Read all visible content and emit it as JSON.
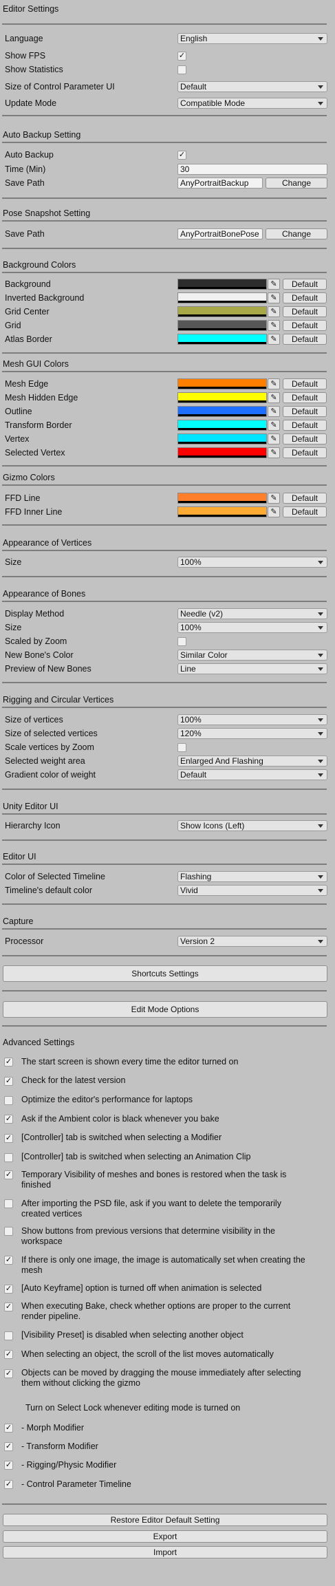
{
  "editor_settings": {
    "header": "Editor Settings",
    "language": {
      "label": "Language",
      "value": "English"
    },
    "show_fps": {
      "label": "Show FPS",
      "checked": true
    },
    "show_statistics": {
      "label": "Show Statistics",
      "checked": false
    },
    "cp_ui_size": {
      "label": "Size of Control Parameter UI",
      "value": "Default"
    },
    "update_mode": {
      "label": "Update Mode",
      "value": "Compatible Mode"
    }
  },
  "auto_backup": {
    "header": "Auto Backup Setting",
    "enabled": {
      "label": "Auto Backup",
      "checked": true
    },
    "time": {
      "label": "Time (Min)",
      "value": "30"
    },
    "save_path": {
      "label": "Save Path",
      "value": "AnyPortraitBackup",
      "button": "Change"
    }
  },
  "pose_snapshot": {
    "header": "Pose Snapshot Setting",
    "save_path": {
      "label": "Save Path",
      "value": "AnyPortraitBonePose",
      "button": "Change"
    }
  },
  "background_colors": {
    "header": "Background Colors",
    "default_label": "Default",
    "items": [
      {
        "label": "Background",
        "color": "#2d2d2d"
      },
      {
        "label": "Inverted Background",
        "color": "#f0f0f0"
      },
      {
        "label": "Grid Center",
        "color": "#a8a848"
      },
      {
        "label": "Grid",
        "color": "#575757"
      },
      {
        "label": "Atlas Border",
        "color": "#00ffff"
      }
    ]
  },
  "mesh_gui_colors": {
    "header": "Mesh GUI Colors",
    "default_label": "Default",
    "items": [
      {
        "label": "Mesh Edge",
        "color": "#ff8000"
      },
      {
        "label": "Mesh Hidden Edge",
        "color": "#ffff00"
      },
      {
        "label": "Outline",
        "color": "#1f6fff"
      },
      {
        "label": "Transform Border",
        "color": "#00ffff"
      },
      {
        "label": "Vertex",
        "color": "#00e5ff"
      },
      {
        "label": "Selected Vertex",
        "color": "#ff0000"
      }
    ]
  },
  "gizmo_colors": {
    "header": "Gizmo Colors",
    "default_label": "Default",
    "items": [
      {
        "label": "FFD Line",
        "color": "#ff7f2a"
      },
      {
        "label": "FFD Inner Line",
        "color": "#ffab33"
      }
    ]
  },
  "appearance_vertices": {
    "header": "Appearance of Vertices",
    "size": {
      "label": "Size",
      "value": "100%"
    }
  },
  "appearance_bones": {
    "header": "Appearance of Bones",
    "display_method": {
      "label": "Display Method",
      "value": "Needle (v2)"
    },
    "size": {
      "label": "Size",
      "value": "100%"
    },
    "scaled_by_zoom": {
      "label": "Scaled by Zoom",
      "checked": false
    },
    "new_bone_color": {
      "label": "New Bone's Color",
      "value": "Similar Color"
    },
    "preview_new_bones": {
      "label": "Preview of New Bones",
      "value": "Line"
    }
  },
  "rigging": {
    "header": "Rigging and Circular Vertices",
    "size_vertices": {
      "label": "Size of vertices",
      "value": "100%"
    },
    "size_selected": {
      "label": "Size of selected vertices",
      "value": "120%"
    },
    "scale_by_zoom": {
      "label": "Scale vertices by Zoom",
      "checked": false
    },
    "weight_area": {
      "label": "Selected weight area",
      "value": "Enlarged And Flashing"
    },
    "gradient": {
      "label": "Gradient color of weight",
      "value": "Default"
    }
  },
  "unity_editor_ui": {
    "header": "Unity Editor UI",
    "hierarchy_icon": {
      "label": "Hierarchy Icon",
      "value": "Show Icons (Left)"
    }
  },
  "editor_ui": {
    "header": "Editor UI",
    "timeline_color": {
      "label": "Color of Selected Timeline",
      "value": "Flashing"
    },
    "timeline_default": {
      "label": "Timeline's default color",
      "value": "Vivid"
    }
  },
  "capture": {
    "header": "Capture",
    "processor": {
      "label": "Processor",
      "value": "Version 2"
    }
  },
  "buttons": {
    "shortcuts": "Shortcuts Settings",
    "edit_mode": "Edit Mode Options",
    "restore": "Restore Editor Default Setting",
    "export": "Export",
    "import": "Import"
  },
  "advanced": {
    "header": "Advanced Settings",
    "items": [
      {
        "label": "The start screen is shown every time the editor turned on",
        "checked": true
      },
      {
        "label": "Check for the latest version",
        "checked": true
      },
      {
        "label": "Optimize the editor's performance for laptops",
        "checked": false
      },
      {
        "label": "Ask if the Ambient color is black whenever you bake",
        "checked": true
      },
      {
        "label": "[Controller] tab is switched when selecting a Modifier",
        "checked": true
      },
      {
        "label": "[Controller] tab is switched when selecting an Animation Clip",
        "checked": false
      },
      {
        "label": "Temporary Visibility of meshes and bones is restored when the task is finished",
        "checked": true
      },
      {
        "label": "After importing the PSD file, ask if you want to delete the temporarily created vertices",
        "checked": false
      },
      {
        "label": "Show buttons from previous versions that determine visibility in the workspace",
        "checked": false
      },
      {
        "label": "If there is only one image, the image is automatically set when creating the mesh",
        "checked": true
      },
      {
        "label": "[Auto Keyframe] option is turned off when animation is selected",
        "checked": true
      },
      {
        "label": "When executing Bake, check whether options are proper to the current render pipeline.",
        "checked": true
      },
      {
        "label": "[Visibility Preset] is disabled when selecting another object",
        "checked": false
      },
      {
        "label": "When selecting an object, the scroll of the list moves automatically",
        "checked": true
      },
      {
        "label": "Objects can be moved by dragging the mouse immediately after selecting them without clicking the gizmo",
        "checked": true
      }
    ],
    "select_lock_label": "Turn on Select Lock whenever editing mode is turned on",
    "lock_items": [
      {
        "label": "- Morph Modifier",
        "checked": true
      },
      {
        "label": "- Transform Modifier",
        "checked": true
      },
      {
        "label": "- Rigging/Physic Modifier",
        "checked": true
      },
      {
        "label": "- Control Parameter Timeline",
        "checked": true
      }
    ]
  }
}
